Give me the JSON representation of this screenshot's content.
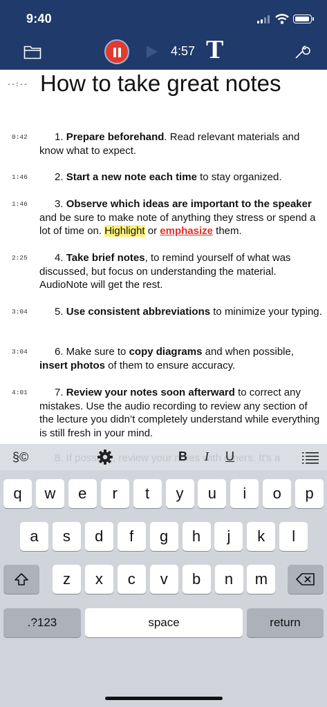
{
  "status_bar": {
    "time": "9:40"
  },
  "toolbar": {
    "recording_time": "4:57",
    "font_button": "T"
  },
  "document": {
    "title_timestamp": "--:--",
    "title": "How to take great notes",
    "items": [
      {
        "ts": "0:42",
        "parts": [
          [
            "",
            "1. "
          ],
          [
            "b",
            "Prepare beforehand"
          ],
          [
            "",
            ". Read relevant materials and know what to expect."
          ]
        ]
      },
      {
        "ts": "1:46",
        "parts": [
          [
            "",
            "2. "
          ],
          [
            "b",
            "Start a new note each time"
          ],
          [
            "",
            " to stay organized."
          ]
        ]
      },
      {
        "ts": "1:46",
        "parts": [
          [
            "",
            "3. "
          ],
          [
            "b",
            "Observe which ideas are important to the speaker"
          ],
          [
            "",
            " and be sure to make note of anything they stress or spend a lot of time on. "
          ],
          [
            "hl",
            "Highlight"
          ],
          [
            "",
            " or "
          ],
          [
            "emph",
            "emphasize"
          ],
          [
            "",
            " them."
          ]
        ]
      },
      {
        "ts": "2:25",
        "parts": [
          [
            "",
            "4. "
          ],
          [
            "b",
            "Take brief notes"
          ],
          [
            "",
            ", to remind yourself of what was discussed, but focus on understanding the material. AudioNote will get the rest."
          ]
        ]
      },
      {
        "ts": "3:04",
        "parts": [
          [
            "",
            "5. "
          ],
          [
            "b",
            "Use consistent abbreviations"
          ],
          [
            "",
            " to minimize your typing."
          ]
        ]
      },
      {
        "ts": "3:04",
        "parts": [
          [
            "",
            "6. Make sure to "
          ],
          [
            "b",
            "copy diagrams"
          ],
          [
            "",
            " and when possible, "
          ],
          [
            "b",
            "insert photos"
          ],
          [
            "",
            " of them to ensure accuracy."
          ]
        ]
      },
      {
        "ts": "4:01",
        "parts": [
          [
            "",
            "7. "
          ],
          [
            "b",
            "Review your notes soon afterward"
          ],
          [
            "",
            " to correct any mistakes. Use the audio recording to review any section of the lecture you didn’t completely understand while everything is still fresh in your mind."
          ]
        ]
      }
    ],
    "next_item_partial": "8. If possible, review your notes with others. It's a"
  },
  "format_bar": {
    "section_symbol": "§©",
    "bold": "B",
    "italic": "I",
    "underline": "U"
  },
  "keyboard": {
    "row1": [
      "q",
      "w",
      "e",
      "r",
      "t",
      "y",
      "u",
      "i",
      "o",
      "p"
    ],
    "row2": [
      "a",
      "s",
      "d",
      "f",
      "g",
      "h",
      "j",
      "k",
      "l"
    ],
    "row3": [
      "z",
      "x",
      "c",
      "v",
      "b",
      "n",
      "m"
    ],
    "numbers_key": ".?123",
    "space_key": "space",
    "return_key": "return"
  }
}
